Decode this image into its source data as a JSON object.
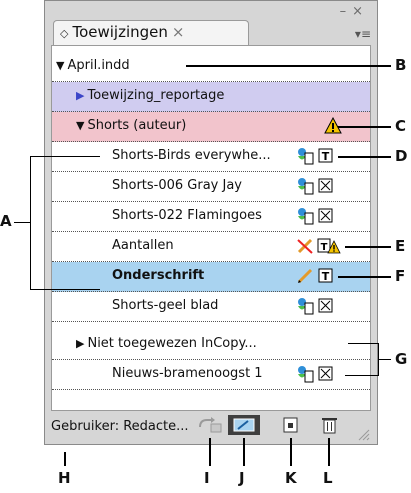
{
  "panel": {
    "tab_title": "Toewijzingen",
    "tab_close": "×",
    "window_controls": "–×",
    "menu_icon": "▾≡"
  },
  "rows": [
    {
      "label": "April.indd",
      "indent": 0,
      "bg": "none",
      "triangle": "down"
    },
    {
      "label": "Toewijzing_reportage",
      "indent": 1,
      "bg": "#d0ccf0",
      "triangle": "right"
    },
    {
      "label": "Shorts (auteur)",
      "indent": 1,
      "bg": "#f2c4cc",
      "triangle": "down",
      "icon": "warning-icon"
    },
    {
      "label": "Shorts-Birds everywhe...",
      "indent": 2,
      "icons": [
        "user-in-use-icon",
        "text-frame-icon"
      ]
    },
    {
      "label": "Shorts-006 Gray Jay",
      "indent": 2,
      "icons": [
        "user-in-use-icon",
        "graphic-frame-icon"
      ]
    },
    {
      "label": "Shorts-022 Flamingoes",
      "indent": 2,
      "icons": [
        "user-in-use-icon",
        "graphic-frame-icon"
      ]
    },
    {
      "label": "Aantallen",
      "indent": 2,
      "icons": [
        "crossed-pencil-icon",
        "text-frame-warning-icon"
      ]
    },
    {
      "label": "Onderschrift",
      "indent": 2,
      "bg": "#a9d3f0",
      "bold": true,
      "icons": [
        "pencil-icon",
        "text-frame-icon"
      ]
    },
    {
      "label": "Shorts-geel blad",
      "indent": 2,
      "icons": [
        "user-in-use-icon",
        "graphic-frame-icon"
      ]
    },
    {
      "label": "Niet toegewezen InCopy...",
      "indent": 1,
      "triangle": "right"
    },
    {
      "label": "Nieuws-bramenoogst 1",
      "indent": 2,
      "icons": [
        "user-in-use-icon",
        "graphic-frame-icon"
      ]
    }
  ],
  "status": {
    "user_label": "Gebruiker: Redacte..."
  },
  "callouts": {
    "A": "A",
    "B": "B",
    "C": "C",
    "D": "D",
    "E": "E",
    "F": "F",
    "G": "G",
    "H": "H",
    "I": "I",
    "J": "J",
    "K": "K",
    "L": "L"
  }
}
